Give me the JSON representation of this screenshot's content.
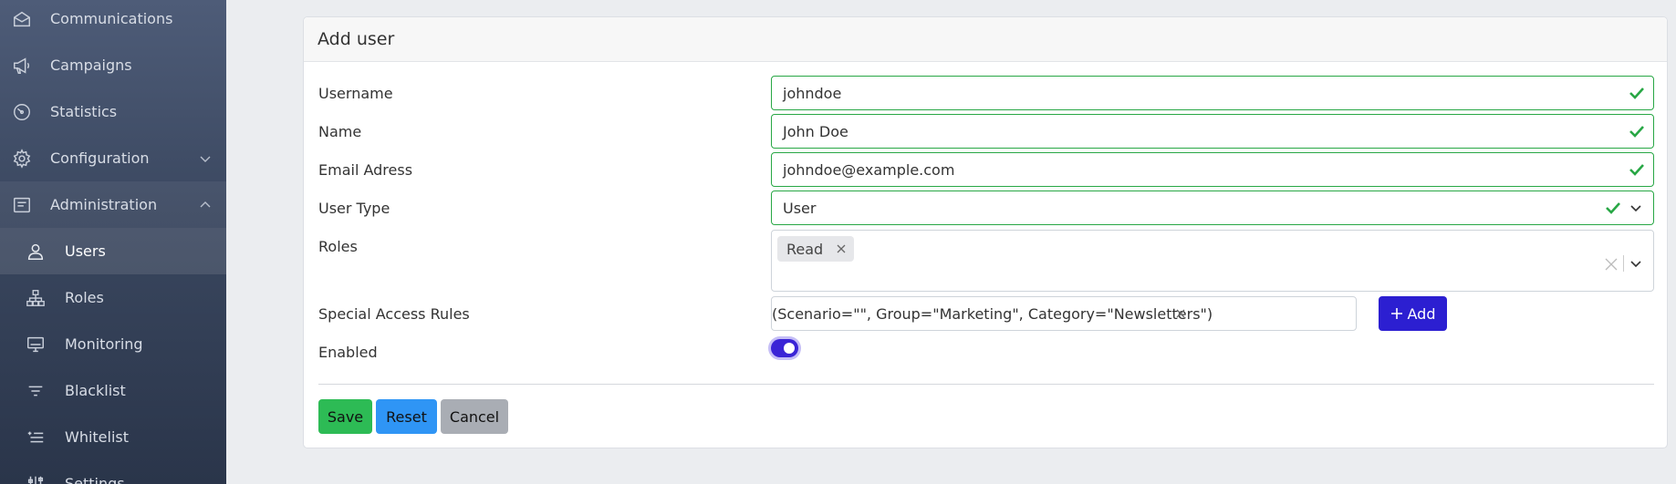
{
  "sidebar": {
    "items": [
      {
        "label": "Communications",
        "icon": "envelope-icon"
      },
      {
        "label": "Campaigns",
        "icon": "megaphone-icon"
      },
      {
        "label": "Statistics",
        "icon": "gauge-icon"
      },
      {
        "label": "Configuration",
        "icon": "gear-icon"
      },
      {
        "label": "Administration",
        "icon": "admin-icon"
      }
    ],
    "sub_items": [
      {
        "label": "Users",
        "icon": "user-icon"
      },
      {
        "label": "Roles",
        "icon": "hierarchy-icon"
      },
      {
        "label": "Monitoring",
        "icon": "monitor-icon"
      },
      {
        "label": "Blacklist",
        "icon": "filter-icon"
      },
      {
        "label": "Whitelist",
        "icon": "list-add-icon"
      },
      {
        "label": "Settings",
        "icon": "sliders-icon"
      }
    ]
  },
  "form": {
    "title": "Add user",
    "username_label": "Username",
    "username_value": "johndoe",
    "name_label": "Name",
    "name_value": "John Doe",
    "email_label": "Email Adress",
    "email_value": "johndoe@example.com",
    "usertype_label": "User Type",
    "usertype_value": "User",
    "roles_label": "Roles",
    "roles_selected": [
      "Read"
    ],
    "rules_label": "Special Access Rules",
    "rules_value": "(Scenario=\"\", Group=\"Marketing\", Category=\"Newsletters\")",
    "add_label": "Add",
    "enabled_label": "Enabled",
    "enabled": true,
    "save_label": "Save",
    "reset_label": "Reset",
    "cancel_label": "Cancel"
  },
  "colors": {
    "valid": "#28a745",
    "primary": "#2c1fd1",
    "save": "#2dbb55",
    "reset": "#2f95f5",
    "cancel": "#a9adb4"
  }
}
